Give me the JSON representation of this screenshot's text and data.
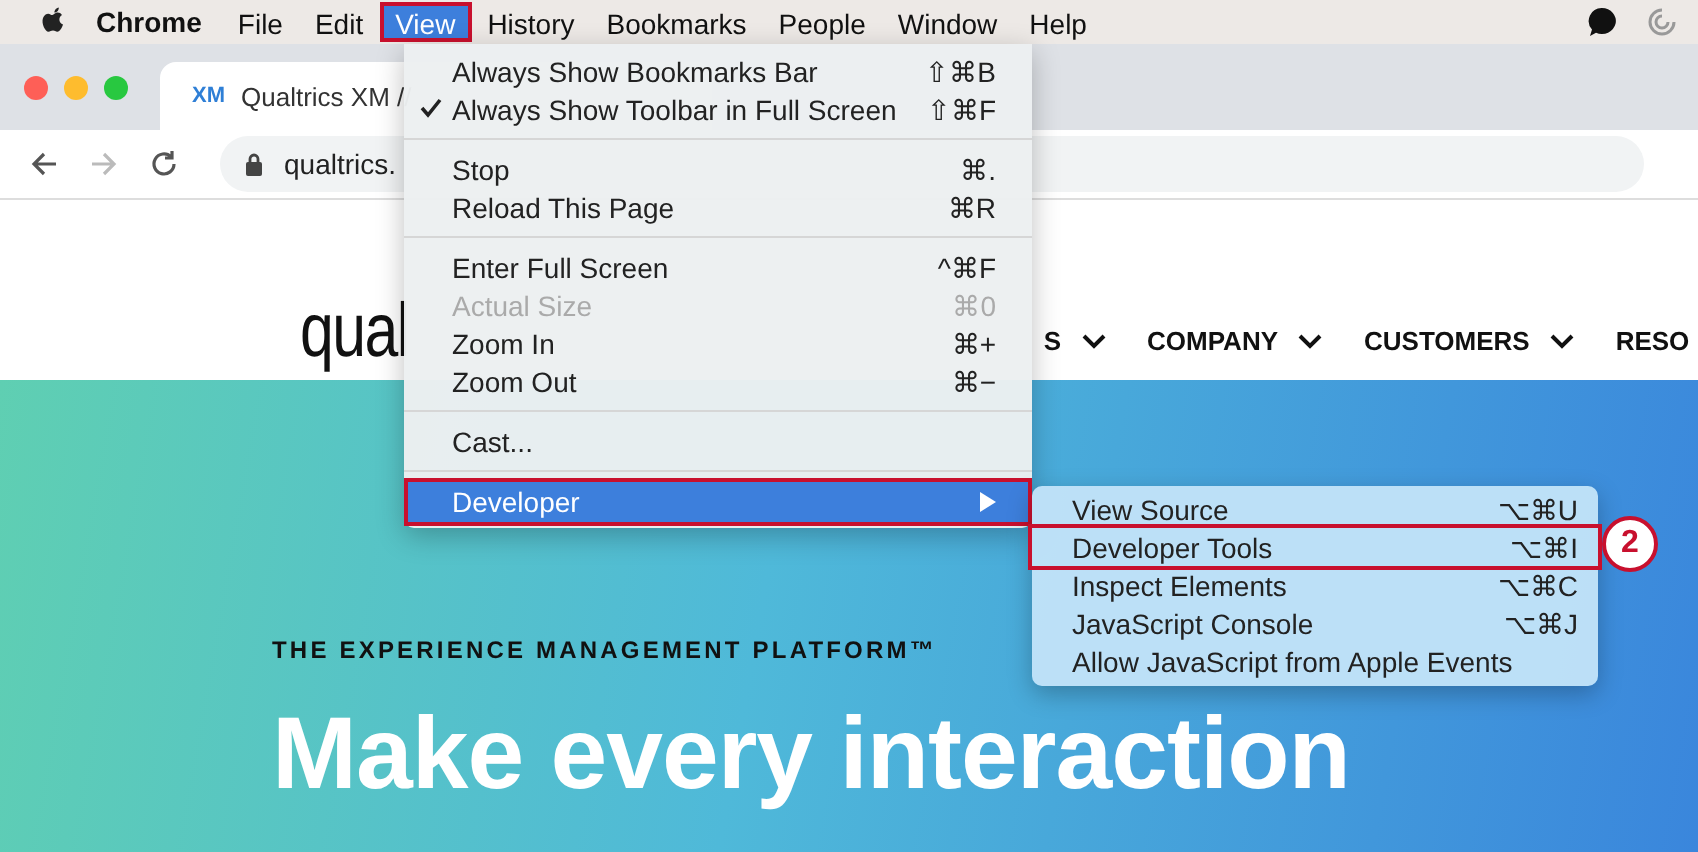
{
  "menubar": {
    "app_name": "Chrome",
    "items": [
      {
        "label": "File",
        "selected": false,
        "outlined": false
      },
      {
        "label": "Edit",
        "selected": false,
        "outlined": false
      },
      {
        "label": "View",
        "selected": true,
        "outlined": true
      },
      {
        "label": "History",
        "selected": false,
        "outlined": false
      },
      {
        "label": "Bookmarks",
        "selected": false,
        "outlined": false
      },
      {
        "label": "People",
        "selected": false,
        "outlined": false
      },
      {
        "label": "Window",
        "selected": false,
        "outlined": false
      },
      {
        "label": "Help",
        "selected": false,
        "outlined": false
      }
    ]
  },
  "browser": {
    "tab": {
      "title": "Qualtrics XM //",
      "favicon": "XM"
    },
    "address": "qualtrics."
  },
  "page": {
    "logo": "qual",
    "nav": [
      "S",
      "COMPANY",
      "CUSTOMERS",
      "RESO"
    ],
    "eyebrow": "THE EXPERIENCE MANAGEMENT PLATFORM™",
    "headline": [
      "Make every interaction"
    ]
  },
  "view_menu": {
    "groups": [
      [
        {
          "label": "Always Show Bookmarks Bar",
          "shortcut": "⇧⌘B",
          "checked": false,
          "disabled": false,
          "selected": false,
          "outlined": false,
          "submenu": false
        },
        {
          "label": "Always Show Toolbar in Full Screen",
          "shortcut": "⇧⌘F",
          "checked": true,
          "disabled": false,
          "selected": false,
          "outlined": false,
          "submenu": false
        }
      ],
      [
        {
          "label": "Stop",
          "shortcut": "⌘.",
          "checked": false,
          "disabled": false,
          "selected": false,
          "outlined": false,
          "submenu": false
        },
        {
          "label": "Reload This Page",
          "shortcut": "⌘R",
          "checked": false,
          "disabled": false,
          "selected": false,
          "outlined": false,
          "submenu": false
        }
      ],
      [
        {
          "label": "Enter Full Screen",
          "shortcut": "^⌘F",
          "checked": false,
          "disabled": false,
          "selected": false,
          "outlined": false,
          "submenu": false
        },
        {
          "label": "Actual Size",
          "shortcut": "⌘0",
          "checked": false,
          "disabled": true,
          "selected": false,
          "outlined": false,
          "submenu": false
        },
        {
          "label": "Zoom In",
          "shortcut": "⌘+",
          "checked": false,
          "disabled": false,
          "selected": false,
          "outlined": false,
          "submenu": false
        },
        {
          "label": "Zoom Out",
          "shortcut": "⌘−",
          "checked": false,
          "disabled": false,
          "selected": false,
          "outlined": false,
          "submenu": false
        }
      ],
      [
        {
          "label": "Cast...",
          "checked": false,
          "disabled": false,
          "selected": false,
          "outlined": false,
          "submenu": false
        }
      ],
      [
        {
          "label": "Developer",
          "checked": false,
          "disabled": false,
          "selected": true,
          "outlined": true,
          "submenu": true
        }
      ]
    ]
  },
  "developer_menu": {
    "items": [
      {
        "label": "View Source",
        "shortcut": "⌥⌘U",
        "outlined": false
      },
      {
        "label": "Developer Tools",
        "shortcut": "⌥⌘I",
        "outlined": true
      },
      {
        "label": "Inspect Elements",
        "shortcut": "⌥⌘C",
        "outlined": false
      },
      {
        "label": "JavaScript Console",
        "shortcut": "⌥⌘J",
        "outlined": false
      },
      {
        "label": "Allow JavaScript from Apple Events",
        "outlined": false
      }
    ]
  },
  "callout": {
    "number": "2"
  }
}
